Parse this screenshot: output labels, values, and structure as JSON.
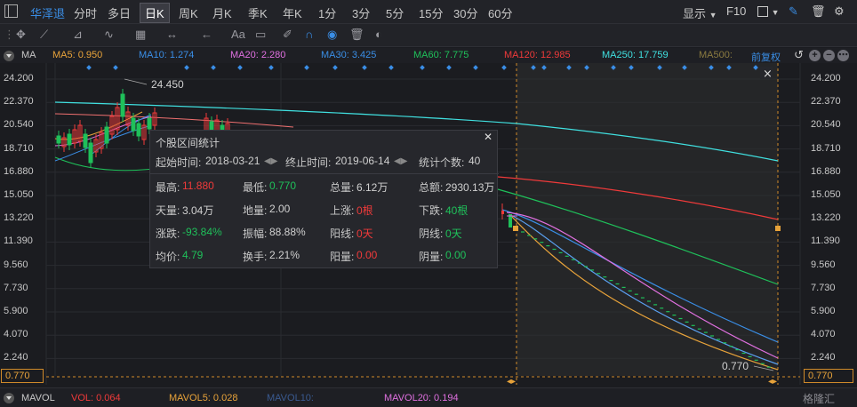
{
  "topbar": {
    "stock_name": "华泽退",
    "periods": [
      "分时",
      "多日",
      "日K",
      "周K",
      "月K",
      "季K",
      "年K",
      "1分",
      "3分",
      "5分",
      "15分",
      "30分",
      "60分"
    ],
    "active_period": "日K",
    "display_label": "显示",
    "f10_label": "F10"
  },
  "tools": {
    "text_tool": "Aa"
  },
  "ma_bar": {
    "label": "MA",
    "items": [
      {
        "text": "MA5: 0.950",
        "color": "#e8a33a"
      },
      {
        "text": "MA10: 1.274",
        "color": "#3a8ee6"
      },
      {
        "text": "MA20: 2.280",
        "color": "#e070e0"
      },
      {
        "text": "MA30: 3.425",
        "color": "#3a8ee6"
      },
      {
        "text": "MA60: 7.775",
        "color": "#1fc05a"
      },
      {
        "text": "MA120: 12.985",
        "color": "#f03a3a"
      },
      {
        "text": "MA250: 17.759",
        "color": "#40e0e0"
      },
      {
        "text": "MA500:",
        "color": "#8a7a40"
      }
    ],
    "fq_label": "前复权"
  },
  "chart": {
    "y_ticks": [
      "24.200",
      "22.370",
      "20.540",
      "18.710",
      "16.880",
      "15.050",
      "13.220",
      "11.390",
      "9.560",
      "7.730",
      "5.900",
      "4.070",
      "2.240"
    ],
    "high_label": "24.450",
    "low_label": "0.770",
    "price_box_left": "0.770",
    "price_box_right": "0.770",
    "colors": {
      "up": "#f03a3a",
      "down": "#1fc05a",
      "selection": "#e8a33a"
    }
  },
  "stats": {
    "title": "个股区间统计",
    "start_label": "起始时间:",
    "start_value": "2018-03-21",
    "end_label": "终止时间:",
    "end_value": "2019-06-14",
    "count_label": "统计个数:",
    "count_value": "40",
    "rows": [
      [
        {
          "label": "最高:",
          "value": "11.880",
          "tone": "red"
        },
        {
          "label": "最低:",
          "value": "0.770",
          "tone": "green"
        },
        {
          "label": "总量:",
          "value": "6.12万",
          "tone": "white"
        },
        {
          "label": "总额:",
          "value": "2930.13万",
          "tone": "white"
        }
      ],
      [
        {
          "label": "天量:",
          "value": "3.04万",
          "tone": "white"
        },
        {
          "label": "地量:",
          "value": "2.00",
          "tone": "white"
        },
        {
          "label": "上涨:",
          "value": "0根",
          "tone": "red"
        },
        {
          "label": "下跌:",
          "value": "40根",
          "tone": "green"
        }
      ],
      [
        {
          "label": "涨跌:",
          "value": "-93.84%",
          "tone": "green"
        },
        {
          "label": "振幅:",
          "value": "88.88%",
          "tone": "white"
        },
        {
          "label": "阳线:",
          "value": "0天",
          "tone": "red"
        },
        {
          "label": "阴线:",
          "value": "0天",
          "tone": "green"
        }
      ],
      [
        {
          "label": "均价:",
          "value": "4.79",
          "tone": "green"
        },
        {
          "label": "换手:",
          "value": "2.21%",
          "tone": "white"
        },
        {
          "label": "阳量:",
          "value": "0.00",
          "tone": "red"
        },
        {
          "label": "阴量:",
          "value": "0.00",
          "tone": "green"
        }
      ]
    ]
  },
  "vol_bar": {
    "label": "MAVOL",
    "items": [
      {
        "text": "VOL: 0.064",
        "color": "#f03a3a"
      },
      {
        "text": "MAVOL5: 0.028",
        "color": "#e8a33a"
      },
      {
        "text": "MAVOL10:",
        "color": "#3a5a90"
      },
      {
        "text": "MAVOL20: 0.194",
        "color": "#e070e0"
      }
    ],
    "watermark": "格隆汇"
  }
}
